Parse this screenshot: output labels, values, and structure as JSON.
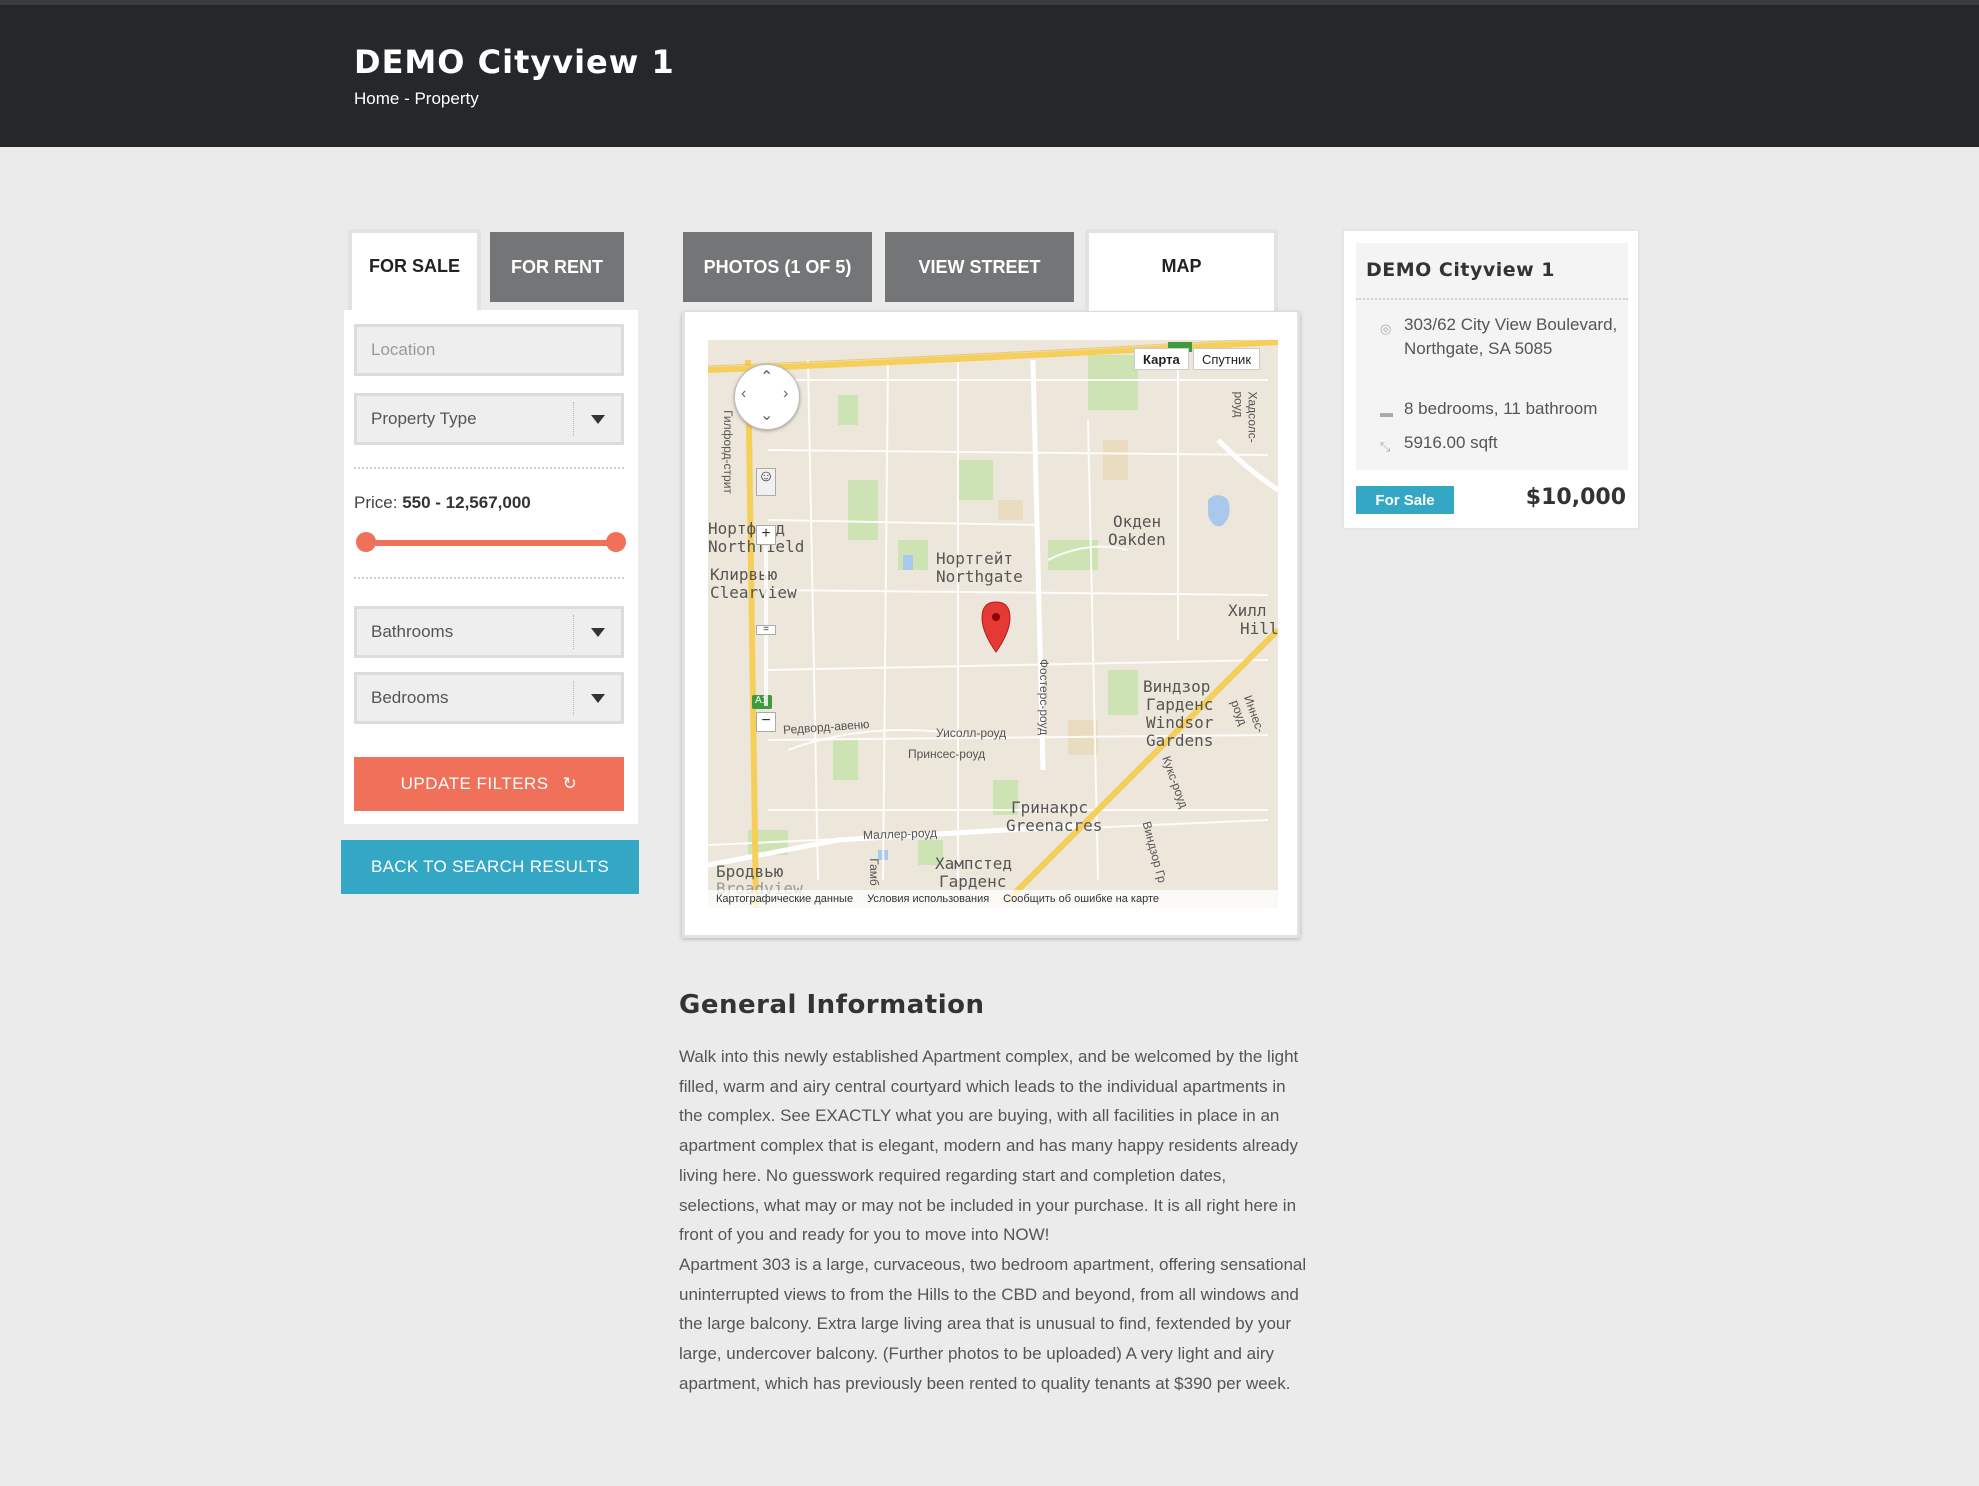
{
  "header": {
    "title": "DEMO Cityview 1",
    "breadcrumb_home": "Home",
    "breadcrumb_sep": " - ",
    "breadcrumb_current": "Property"
  },
  "search": {
    "tabs": [
      "FOR SALE",
      "FOR RENT"
    ],
    "active_tab": "FOR SALE",
    "location_placeholder": "Location",
    "property_type": "Property Type",
    "price_label": "Price:",
    "price_range": "550 - 12,567,000",
    "bathrooms": "Bathrooms",
    "bedrooms": "Bedrooms",
    "update_button": "UPDATE FILTERS",
    "back_button": "BACK TO SEARCH RESULTS"
  },
  "media": {
    "tabs": [
      "PHOTOS (1 OF 5)",
      "VIEW STREET",
      "MAP"
    ],
    "active_tab": "MAP",
    "map": {
      "type_map": "Карта",
      "type_satellite": "Спутник",
      "footer": [
        "Картографические данные",
        "Условия использования",
        "Сообщить об ошибке на карте"
      ],
      "labels": [
        "Нортфилд",
        "Northfield",
        "Клирвью",
        "Clearview",
        "Нортгейт",
        "Northgate",
        "Окден",
        "Oakden",
        "Хилл",
        "Hill",
        "Виндзор",
        "Гарденс",
        "Windsor",
        "Gardens",
        "Гринакрс",
        "Greenacres",
        "Хампстед",
        "Гарденс",
        "Бродвью",
        "Broadview"
      ],
      "streets": [
        "Гилфорд-стрит",
        "Редворд-авеню",
        "Уисолл-роуд",
        "Принсес-роуд",
        "Фостерс-роуд",
        "Маллер-роуд",
        "Гамб",
        "Кукс-роуд",
        "Виндзор Гр",
        "Иннес-роуд",
        "Хадсолс-роуд",
        "А1"
      ]
    }
  },
  "property": {
    "title": "DEMO Cityview 1",
    "address": "303/62 City View Boulevard, Northgate, SA 5085",
    "rooms": "8 bedrooms, 11 bathroom",
    "area": "5916.00 sqft",
    "status": "For Sale",
    "price": "$10,000"
  },
  "general_info": {
    "title": "General Information",
    "paragraphs": [
      "Walk into this newly established Apartment complex, and be welcomed by the light filled, warm and airy central courtyard which leads to the individual apartments in the complex. See EXACTLY what you are buying, with all facilities in place in an apartment complex that is elegant, modern and has many happy residents already living here. No guesswork required regarding start and completion dates, selections, what may or may not be included in your purchase. It is all right here in front of you and ready for you to move into NOW!",
      "Apartment 303 is a large, curvaceous, two bedroom apartment, offering sensational uninterrupted views to from the Hills to the CBD and beyond, from all windows and the large balcony. Extra large living area that is unusual to find, fextended by your large, undercover balcony. (Further photos to be uploaded) A very light and airy apartment, which has previously been rented to quality tenants at $390 per week."
    ]
  },
  "colors": {
    "accent_orange": "#f0705a",
    "accent_blue": "#34a7c4",
    "header_bg": "#25282b",
    "tab_inactive": "#737576",
    "page_bg": "#ebebec"
  }
}
